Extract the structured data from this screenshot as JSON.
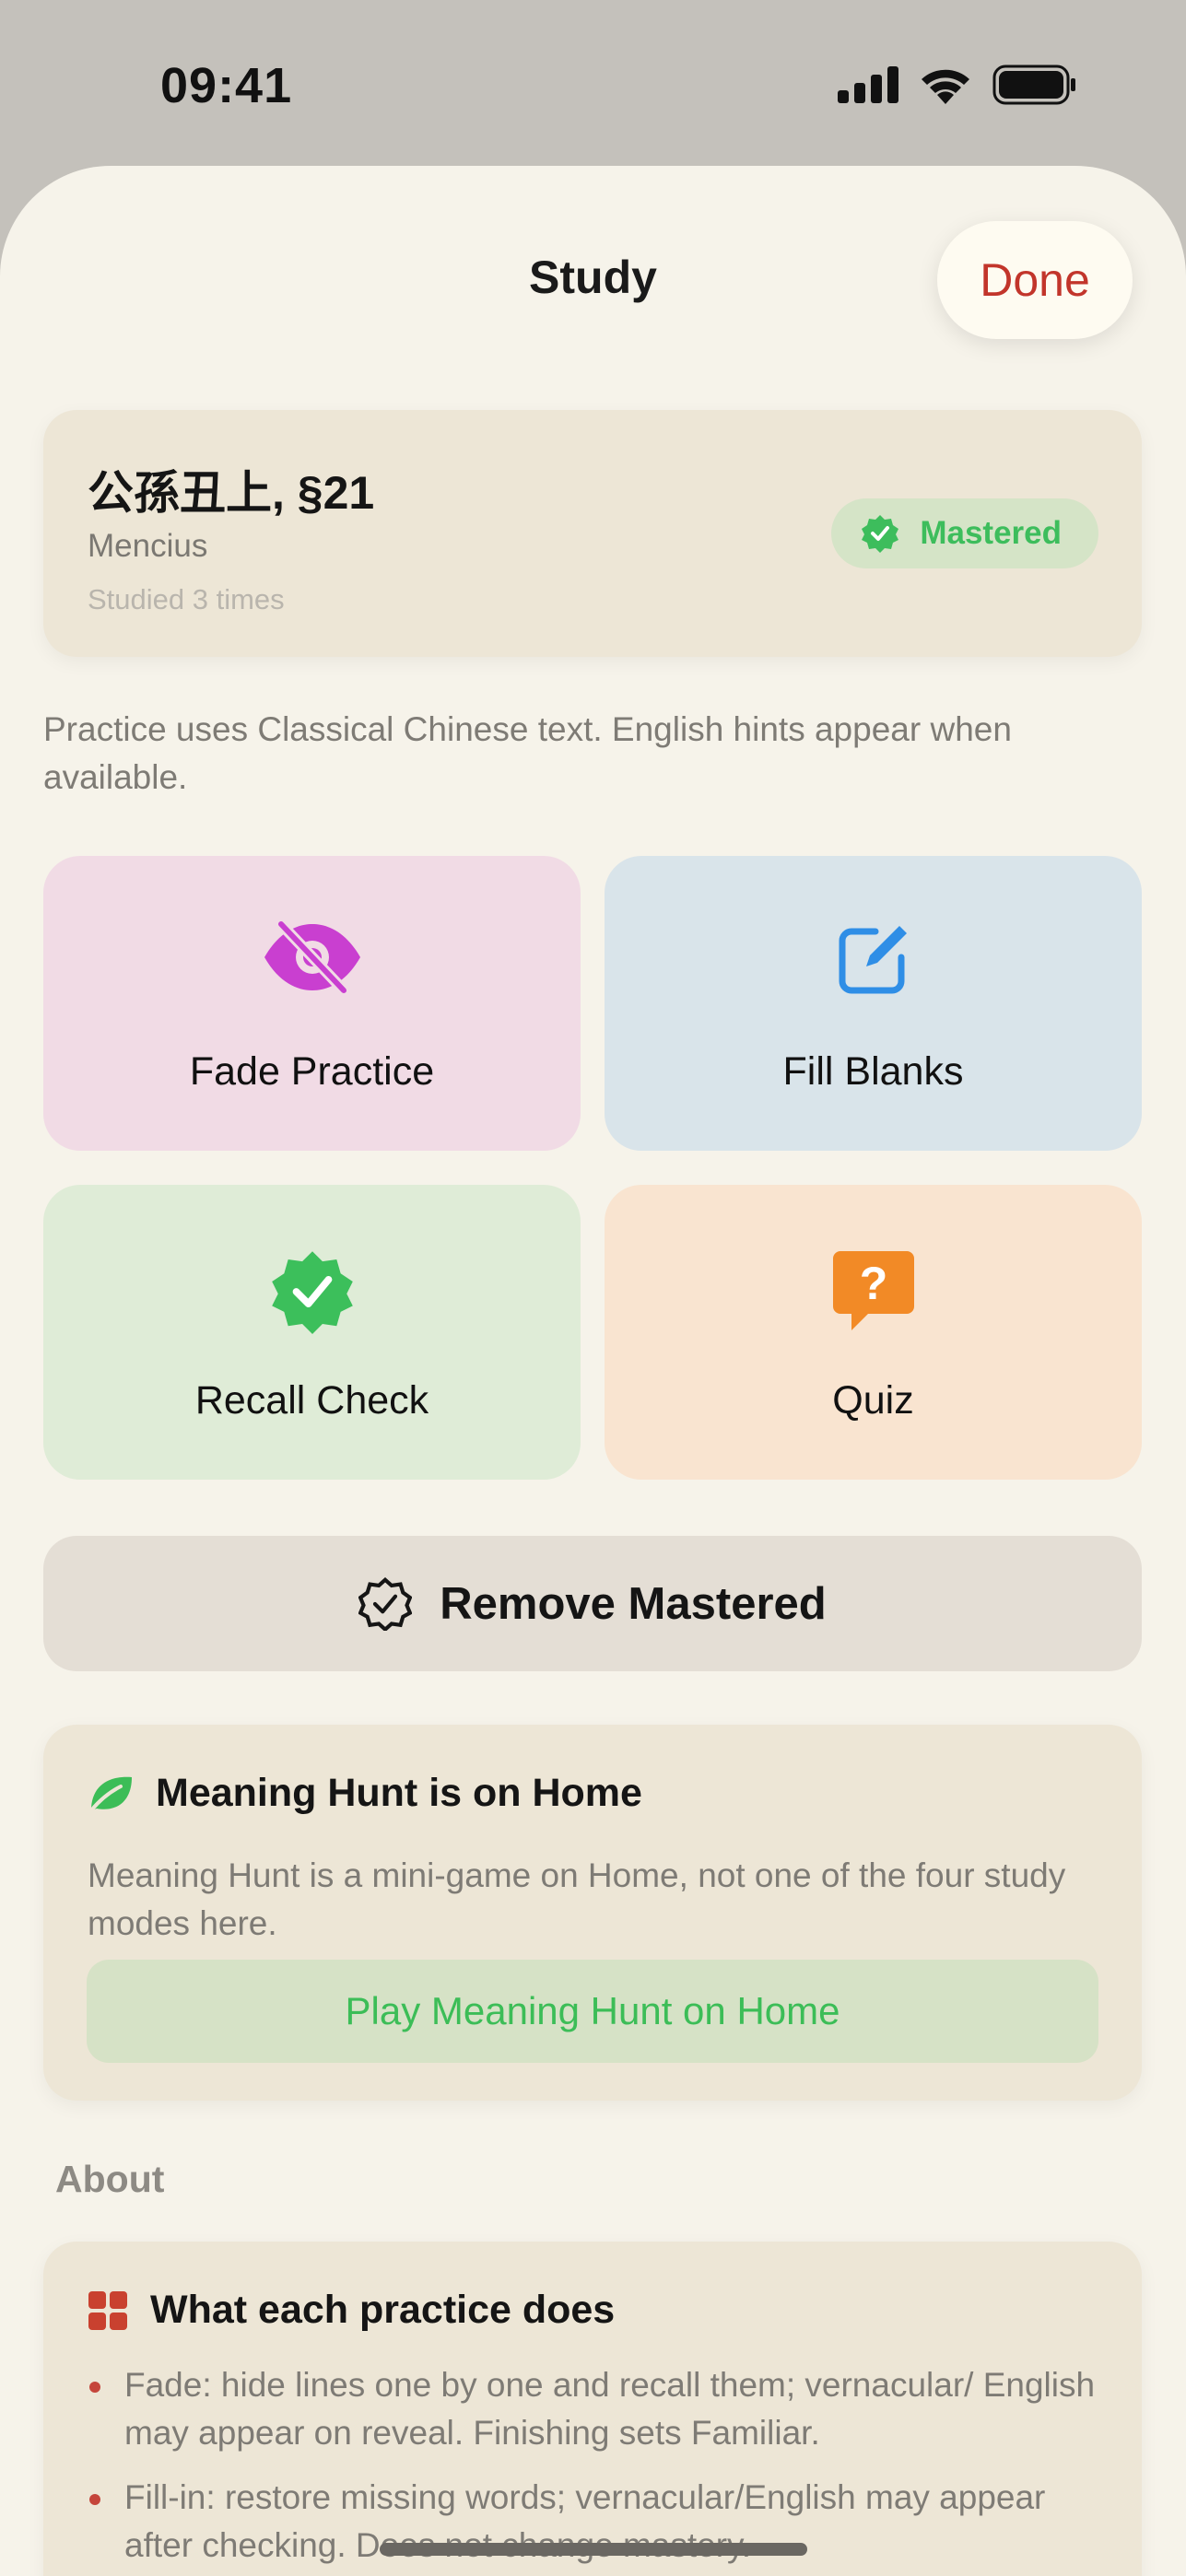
{
  "status_bar": {
    "time": "09:41",
    "icons": [
      "cellular-signal-icon",
      "wifi-icon",
      "battery-icon"
    ]
  },
  "nav": {
    "title": "Study",
    "done_label": "Done"
  },
  "passage": {
    "title": "公孫丑上, §21",
    "source": "Mencius",
    "studied": "Studied 3 times",
    "status_label": "Mastered"
  },
  "hint": "Practice uses Classical Chinese text. English hints appear when available.",
  "modes": [
    {
      "label": "Fade Practice",
      "icon": "eye-slash-icon",
      "color": "#c93fd0"
    },
    {
      "label": "Fill Blanks",
      "icon": "square-pencil-icon",
      "color": "#2f8ee6"
    },
    {
      "label": "Recall Check",
      "icon": "checkmark-seal-icon",
      "color": "#3cbf5b"
    },
    {
      "label": "Quiz",
      "icon": "question-bubble-icon",
      "color": "#f28a26"
    }
  ],
  "remove_mastered": {
    "label": "Remove Mastered",
    "icon": "checkmark-seal-outline-icon"
  },
  "meaning_hunt": {
    "title": "Meaning Hunt is on Home",
    "description": "Meaning Hunt is a mini-game on Home, not one of the four study modes here.",
    "button_label": "Play Meaning Hunt on Home",
    "icon": "leaf-icon"
  },
  "about": {
    "section_label": "About",
    "title": "What each practice does",
    "icon": "grid-icon",
    "items": [
      "Fade: hide lines one by one and recall them; vernacular/ English may appear on reveal. Finishing sets Familiar.",
      "Fill-in: restore missing words; vernacular/English may appear after checking. Does not change mastery."
    ]
  },
  "colors": {
    "accent_red": "#c2352b",
    "success_green": "#3dbd5c",
    "sheet_background": "#f6f3ea",
    "card_background": "#ede6d6"
  }
}
